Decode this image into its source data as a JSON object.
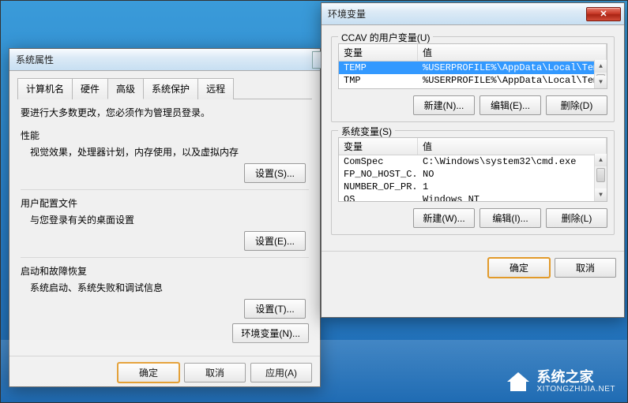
{
  "sysprop": {
    "title": "系统属性",
    "tabs": [
      "计算机名",
      "硬件",
      "高级",
      "系统保护",
      "远程"
    ],
    "activeTab": 2,
    "adminNote": "要进行大多数更改，您必须作为管理员登录。",
    "sections": [
      {
        "label": "性能",
        "desc": "视觉效果，处理器计划，内存使用，以及虚拟内存",
        "btn": "设置(S)..."
      },
      {
        "label": "用户配置文件",
        "desc": "与您登录有关的桌面设置",
        "btn": "设置(E)..."
      },
      {
        "label": "启动和故障恢复",
        "desc": "系统启动、系统失败和调试信息",
        "btn": "设置(T)..."
      }
    ],
    "envBtn": "环境变量(N)...",
    "footer": {
      "ok": "确定",
      "cancel": "取消",
      "apply": "应用(A)"
    }
  },
  "envvar": {
    "title": "环境变量",
    "userSectionLabel": "CCAV 的用户变量(U)",
    "sysSectionLabel": "系统变量(S)",
    "columns": {
      "var": "变量",
      "val": "值"
    },
    "userVars": [
      {
        "name": "TEMP",
        "value": "%USERPROFILE%\\AppData\\Local\\Temp",
        "selected": true
      },
      {
        "name": "TMP",
        "value": "%USERPROFILE%\\AppData\\Local\\Temp",
        "selected": false
      }
    ],
    "sysVars": [
      {
        "name": "ComSpec",
        "value": "C:\\Windows\\system32\\cmd.exe"
      },
      {
        "name": "FP_NO_HOST_C...",
        "value": "NO"
      },
      {
        "name": "NUMBER_OF_PR...",
        "value": "1"
      },
      {
        "name": "OS",
        "value": "Windows_NT"
      }
    ],
    "userBtns": {
      "new": "新建(N)...",
      "edit": "编辑(E)...",
      "del": "删除(D)"
    },
    "sysBtns": {
      "new": "新建(W)...",
      "edit": "编辑(I)...",
      "del": "删除(L)"
    },
    "footer": {
      "ok": "确定",
      "cancel": "取消"
    }
  },
  "watermark": {
    "name": "系统之家",
    "url": "XITONGZHIJIA.NET"
  }
}
